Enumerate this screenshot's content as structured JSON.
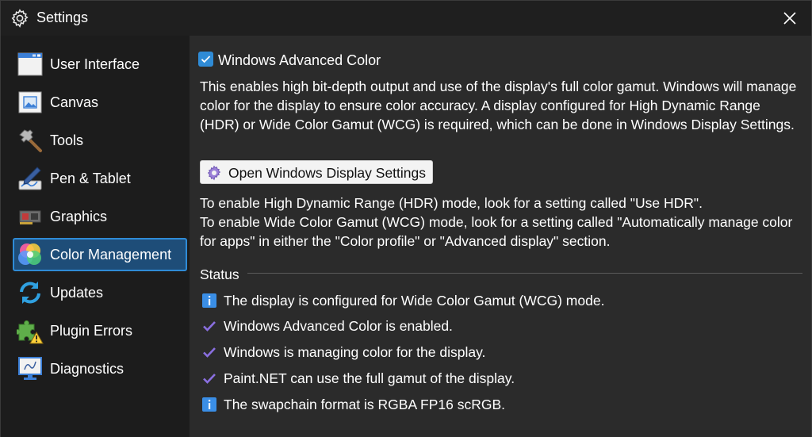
{
  "window": {
    "title": "Settings"
  },
  "sidebar": {
    "items": [
      {
        "label": "User Interface",
        "icon": "window-icon"
      },
      {
        "label": "Canvas",
        "icon": "image-icon"
      },
      {
        "label": "Tools",
        "icon": "hammer-icon"
      },
      {
        "label": "Pen & Tablet",
        "icon": "pen-tablet-icon"
      },
      {
        "label": "Graphics",
        "icon": "graphics-card-icon"
      },
      {
        "label": "Color Management",
        "icon": "color-circles-icon",
        "selected": true
      },
      {
        "label": "Updates",
        "icon": "refresh-icon"
      },
      {
        "label": "Plugin Errors",
        "icon": "puzzle-warning-icon"
      },
      {
        "label": "Diagnostics",
        "icon": "monitor-diagnostics-icon"
      }
    ]
  },
  "main": {
    "advanced_color": {
      "label": "Windows Advanced Color",
      "checked": true
    },
    "description": "This enables high bit-depth output and use of the display's full color gamut. Windows will manage color for the display to ensure color accuracy. A display configured for High Dynamic Range (HDR) or Wide Color Gamut (WCG) is required, which can be done in Windows Display Settings.",
    "open_settings_button": "Open Windows Display Settings",
    "hdr_hint": "To enable High Dynamic Range (HDR) mode, look for a setting called \"Use HDR\".",
    "wcg_hint": "To enable Wide Color Gamut (WCG) mode, look for a setting called \"Automatically manage color for apps\" in either the \"Color profile\" or \"Advanced display\" section.",
    "status": {
      "heading": "Status",
      "items": [
        {
          "icon": "info-icon",
          "text": "The display is configured for Wide Color Gamut (WCG) mode."
        },
        {
          "icon": "check-icon",
          "text": "Windows Advanced Color is enabled."
        },
        {
          "icon": "check-icon",
          "text": "Windows is managing color for the display."
        },
        {
          "icon": "check-icon",
          "text": "Paint.NET can use the full gamut of the display."
        },
        {
          "icon": "info-icon",
          "text": "The swapchain format is RGBA FP16 scRGB."
        }
      ]
    }
  },
  "colors": {
    "accent": "#2f8bd6",
    "selected_bg": "#1e4d78",
    "check_purple": "#8a6fe0",
    "info_blue": "#3a8ee6"
  }
}
